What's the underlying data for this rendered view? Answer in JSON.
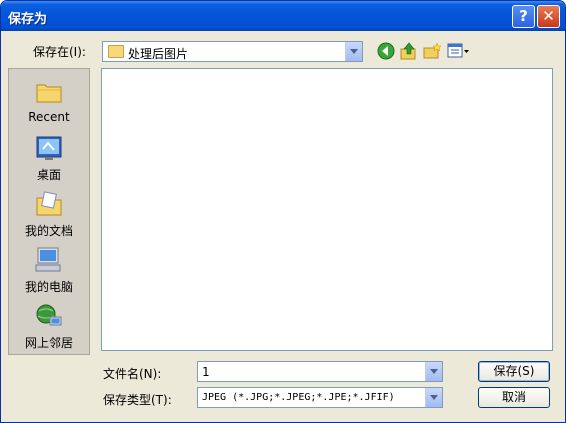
{
  "dialog": {
    "title": "保存为",
    "help_button": "?",
    "close_button": "✕"
  },
  "location": {
    "label": "保存在(I):",
    "value": "处理后图片"
  },
  "places": [
    {
      "label": "Recent",
      "icon": "recent-folder-icon"
    },
    {
      "label": "桌面",
      "icon": "desktop-icon"
    },
    {
      "label": "我的文档",
      "icon": "my-documents-icon"
    },
    {
      "label": "我的电脑",
      "icon": "my-computer-icon"
    },
    {
      "label": "网上邻居",
      "icon": "network-places-icon"
    }
  ],
  "filename": {
    "label": "文件名(N):",
    "value": "1"
  },
  "filetype": {
    "label": "保存类型(T):",
    "value": "JPEG (*.JPG;*.JPEG;*.JPE;*.JFIF)"
  },
  "buttons": {
    "save": "保存(S)",
    "cancel": "取消"
  }
}
